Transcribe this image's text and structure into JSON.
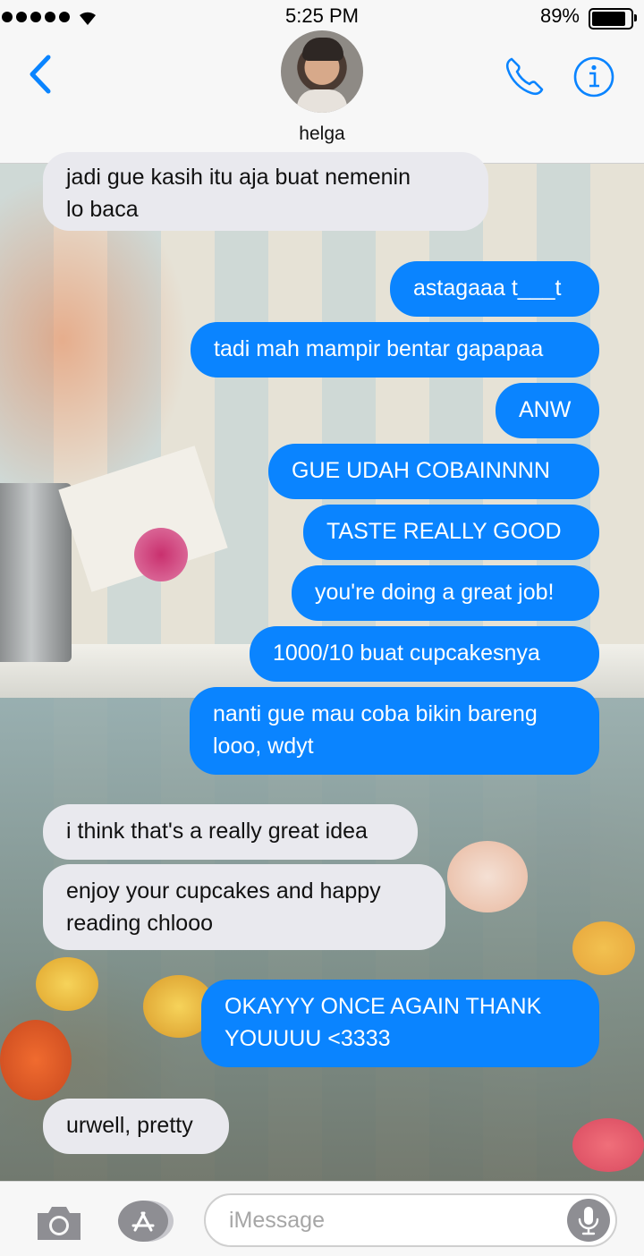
{
  "status_bar": {
    "time": "5:25 PM",
    "battery_percent": "89%",
    "battery_level": 0.89,
    "signal_dots": 5
  },
  "header": {
    "contact_name": "helga",
    "back_icon": "chevron-left-icon",
    "call_icon": "phone-icon",
    "info_icon": "info-icon"
  },
  "colors": {
    "accent": "#0a84ff",
    "received_bubble": "#e9e9ee",
    "header_bg": "#f7f7f7"
  },
  "messages": [
    {
      "direction": "received",
      "text": "jadi gue kasih itu aja buat nemenin\nlo baca"
    },
    {
      "direction": "sent",
      "text": "astagaaa t___t"
    },
    {
      "direction": "sent",
      "text": "tadi mah mampir bentar gapapaa"
    },
    {
      "direction": "sent",
      "text": "ANW"
    },
    {
      "direction": "sent",
      "text": "GUE UDAH COBAINNNN"
    },
    {
      "direction": "sent",
      "text": "TASTE REALLY GOOD"
    },
    {
      "direction": "sent",
      "text": "you're doing a great job!"
    },
    {
      "direction": "sent",
      "text": "1000/10 buat cupcakesnya"
    },
    {
      "direction": "sent",
      "text": "nanti gue mau coba bikin bareng\nlooo, wdyt"
    },
    {
      "direction": "received",
      "text": "i think that's a really great idea"
    },
    {
      "direction": "received",
      "text": "enjoy your cupcakes and happy\nreading chlooo"
    },
    {
      "direction": "sent",
      "text": "OKAYYY ONCE AGAIN THANK\nYOUUUU <3333"
    },
    {
      "direction": "received",
      "text": "urwell, pretty"
    }
  ],
  "composer": {
    "placeholder": "iMessage",
    "camera_icon": "camera-icon",
    "apps_icon": "app-store-icon",
    "mic_icon": "microphone-icon"
  }
}
